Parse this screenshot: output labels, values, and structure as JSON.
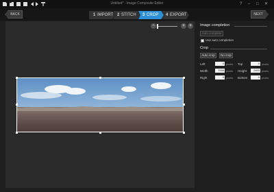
{
  "app": {
    "title": "Untitled* - Image Composite Editor"
  },
  "titlebar": {
    "icons": [
      "new-project-icon",
      "open-icon",
      "save-icon",
      "save-as-icon",
      "undo-icon",
      "redo-icon",
      "new-panorama-icon"
    ],
    "window_buttons": [
      "?",
      "–",
      "□",
      "✕"
    ]
  },
  "nav": {
    "back_label": "BACK",
    "next_label": "NEXT",
    "steps": [
      {
        "num": "1",
        "label": "IMPORT"
      },
      {
        "num": "2",
        "label": "STITCH"
      },
      {
        "num": "3",
        "label": "CROP"
      },
      {
        "num": "4",
        "label": "EXPORT"
      }
    ]
  },
  "zoom": {
    "minus": "−",
    "plus": "+",
    "plus2": "+",
    "level": 0.0
  },
  "panel": {
    "completion": {
      "title": "Image completion",
      "auto_complete_label": "Auto complete",
      "use_auto_label": "Use auto completion"
    },
    "crop": {
      "title": "Crop",
      "auto_crop_label": "Auto crop",
      "no_crop_label": "No crop",
      "fields": {
        "left": {
          "label": "Left",
          "value": "0",
          "unit": "pixels"
        },
        "top": {
          "label": "Top",
          "value": "0",
          "unit": "pixels"
        },
        "width": {
          "label": "Width",
          "value": "7938",
          "unit": "pixels"
        },
        "height": {
          "label": "Height",
          "value": "2493",
          "unit": "pixels"
        },
        "right": {
          "label": "Right",
          "value": "0",
          "unit": "pixels"
        },
        "bottom": {
          "label": "Bottom",
          "value": "0",
          "unit": "pixels"
        }
      }
    }
  },
  "colors": {
    "accent": "#2d8fd5",
    "background": "#1e1e1e",
    "canvas": "#2b2b2b"
  }
}
